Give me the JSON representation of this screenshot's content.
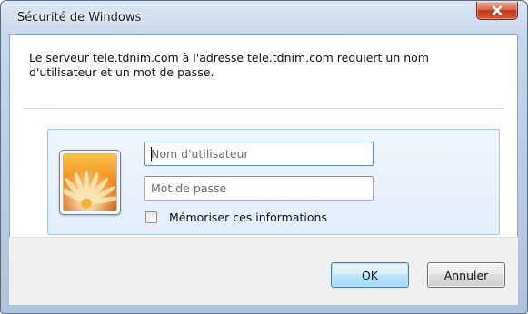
{
  "window": {
    "title": "Sécurité de Windows"
  },
  "dialog": {
    "message": "Le serveur tele.tdnim.com à l'adresse tele.tdnim.com requiert un nom d'utilisateur et un mot de passe.",
    "username": {
      "value": "",
      "placeholder": "Nom d'utilisateur"
    },
    "password": {
      "value": "",
      "placeholder": "Mot de passe"
    },
    "remember": {
      "label": "Mémoriser ces informations",
      "checked": false
    },
    "avatar_icon": "user-tile-flower-icon"
  },
  "buttons": {
    "ok_label": "OK",
    "cancel_label": "Annuler"
  },
  "colors": {
    "close_button": "#c0381b",
    "ok_button_accent": "#3c7fb1",
    "credential_panel": "#e3eefb"
  }
}
